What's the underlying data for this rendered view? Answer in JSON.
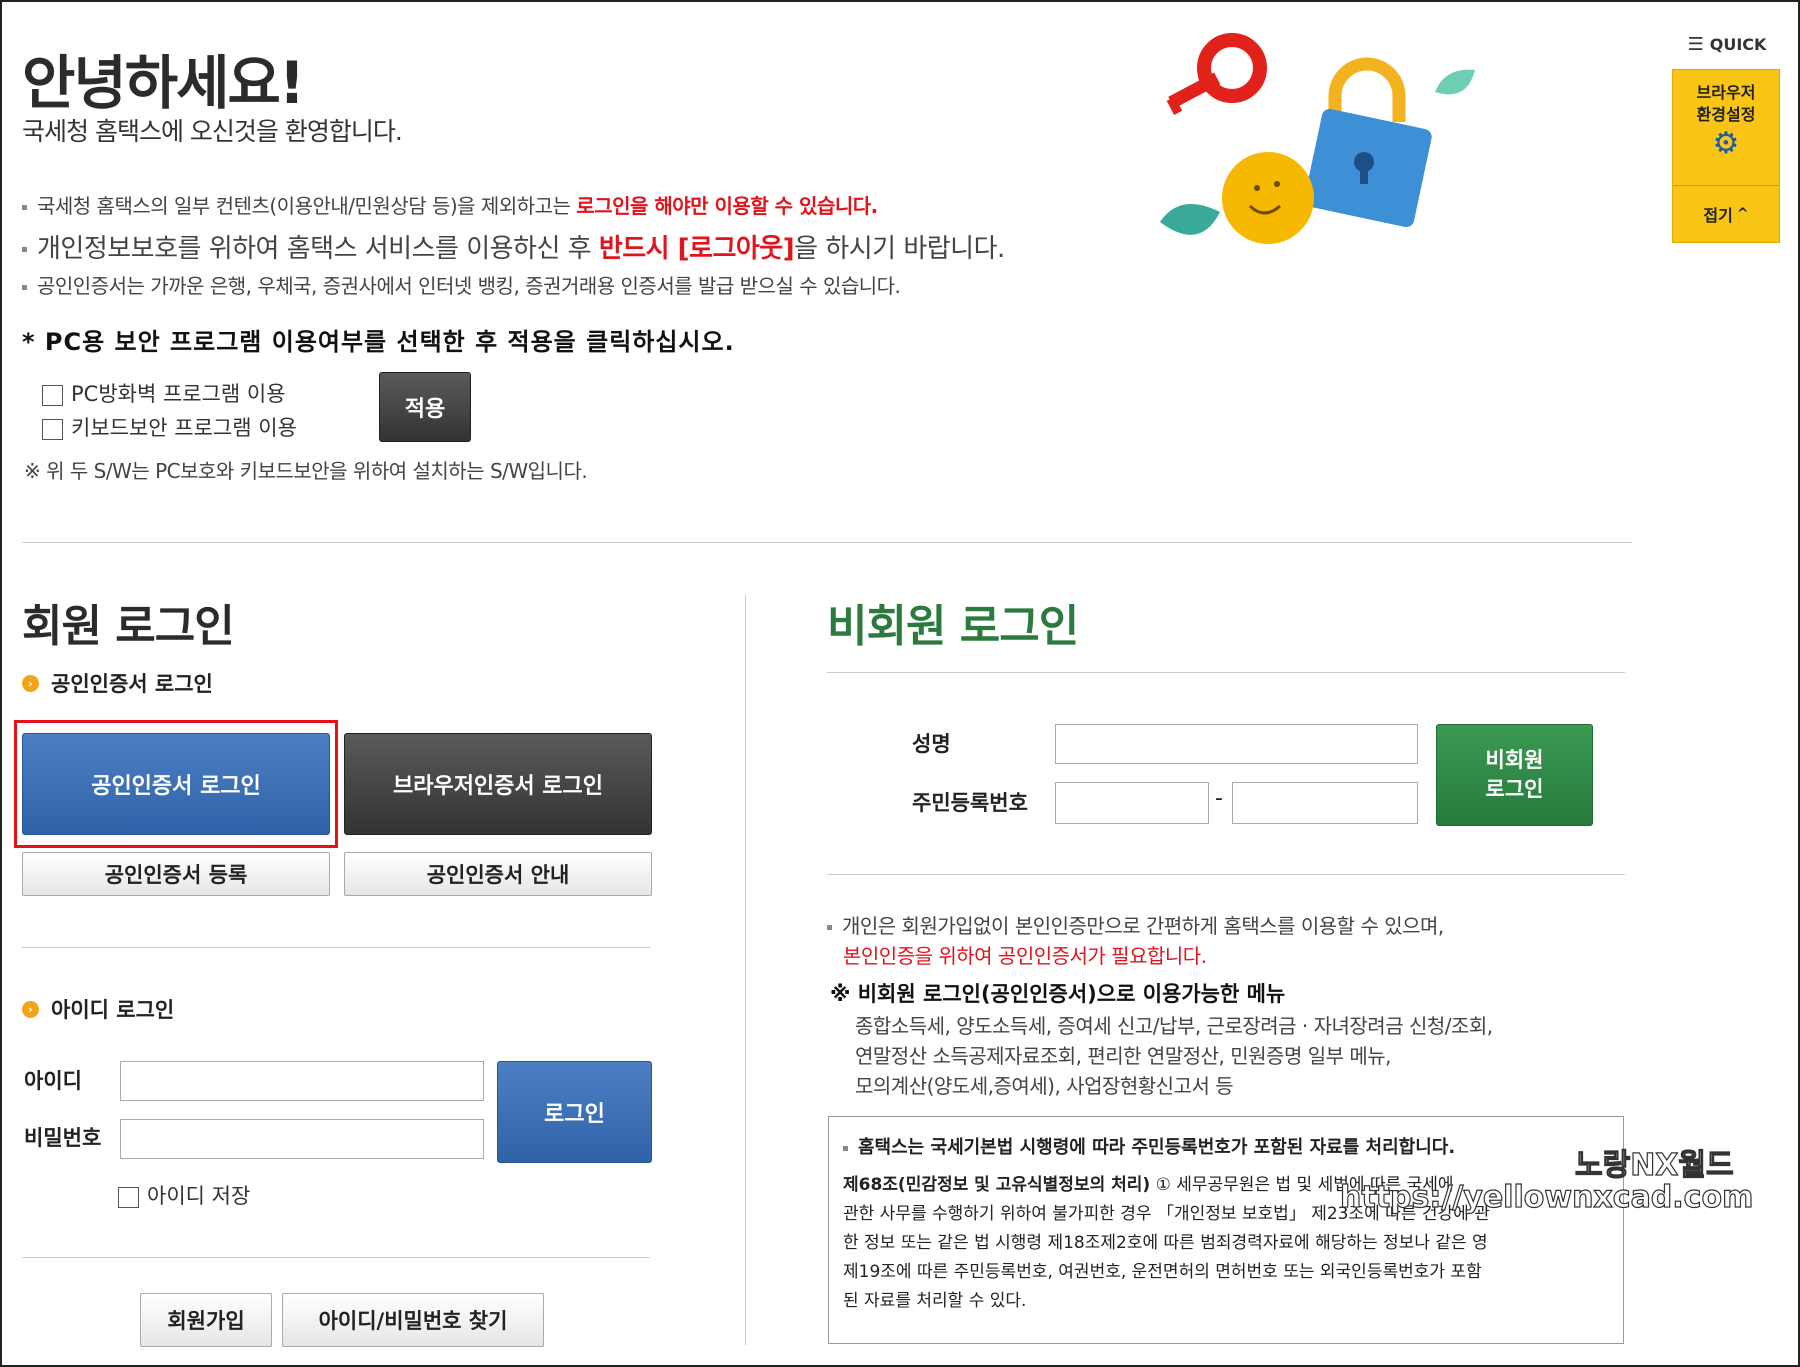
{
  "greeting": {
    "hello": "안녕하세요!",
    "welcome": "국세청 홈택스에 오신것을 환영합니다."
  },
  "notices": {
    "line1_prefix": "국세청 홈택스의 일부 컨텐츠(이용안내/민원상담 등)을 제외하고는 ",
    "line1_highlight": "로그인을 해야만 이용할 수 있습니다.",
    "line2_prefix": "개인정보보호를 위하여 홈택스 서비스를 이용하신 후 ",
    "line2_highlight": "반드시 [로그아웃]",
    "line2_suffix": "을 하시기 바랍니다.",
    "line3": "공인인증서는 가까운 은행, 우체국, 증권사에서 인터넷 뱅킹, 증권거래용 인증서를 발급 받으실 수 있습니다."
  },
  "security": {
    "instruction": "* PC용 보안 프로그램 이용여부를 선택한 후 적용을 클릭하십시오.",
    "firewall_label": "PC방화벽 프로그램 이용",
    "keyboard_label": "키보드보안 프로그램 이용",
    "apply_label": "적용",
    "footnote": "※ 위 두 S/W는 PC보호와 키보드보안을 위하여 설치하는 S/W입니다."
  },
  "quick": {
    "title": "QUICK",
    "browser_settings": "브라우저 환경설정",
    "collapse": "접기"
  },
  "member": {
    "title": "회원 로그인",
    "cert_section": "공인인증서 로그인",
    "cert_login": "공인인증서 로그인",
    "browser_cert_login": "브라우저인증서 로그인",
    "cert_register": "공인인증서 등록",
    "cert_guide": "공인인증서 안내",
    "id_section": "아이디 로그인",
    "id_label": "아이디",
    "password_label": "비밀번호",
    "login_button": "로그인",
    "save_id": "아이디 저장",
    "signup": "회원가입",
    "find_account": "아이디/비밀번호 찾기"
  },
  "guest": {
    "title": "비회원 로그인",
    "name_label": "성명",
    "rrn_label": "주민등록번호",
    "rrn_separator": "-",
    "login_button": "비회원 로그인",
    "info1": "개인은 회원가입없이 본인인증만으로 간편하게 홈택스를 이용할 수 있으며,",
    "info2": "본인인증을 위하여 공인인증서가 필요합니다.",
    "menu_title": "※ 비회원 로그인(공인인증서)으로 이용가능한 메뉴",
    "menu_line1": "종합소득세, 양도소득세, 증여세 신고/납부, 근로장려금 · 자녀장려금 신청/조회,",
    "menu_line2": "연말정산 소득공제자료조회, 편리한 연말정산, 민원증명 일부 메뉴,",
    "menu_line3": "모의계산(양도세,증여세), 사업장현황신고서 등",
    "legal_title": "홈택스는 국세기본법 시행령에 따라 주민등록번호가 포함된 자료를 처리합니다.",
    "legal_heading": "제68조(민감정보 및 고유식별정보의 처리)",
    "legal_line1": " ① 세무공무원은 법 및 세법에 따른 국세에",
    "legal_line2": "관한 사무를 수행하기 위하여 불가피한 경우 「개인정보 보호법」 제23조에 따른 건강에 관",
    "legal_line3": "한 정보 또는 같은 법 시행령 제18조제2호에 따른 범죄경력자료에 해당하는 정보나 같은 영",
    "legal_line4": "제19조에 따른 주민등록번호, 여권번호, 운전면허의 면허번호 또는 외국인등록번호가 포함",
    "legal_line5": "된 자료를 처리할 수 있다."
  },
  "watermark": {
    "line1": "노랑NX월드",
    "line2": "https://yellownxcad.com"
  }
}
